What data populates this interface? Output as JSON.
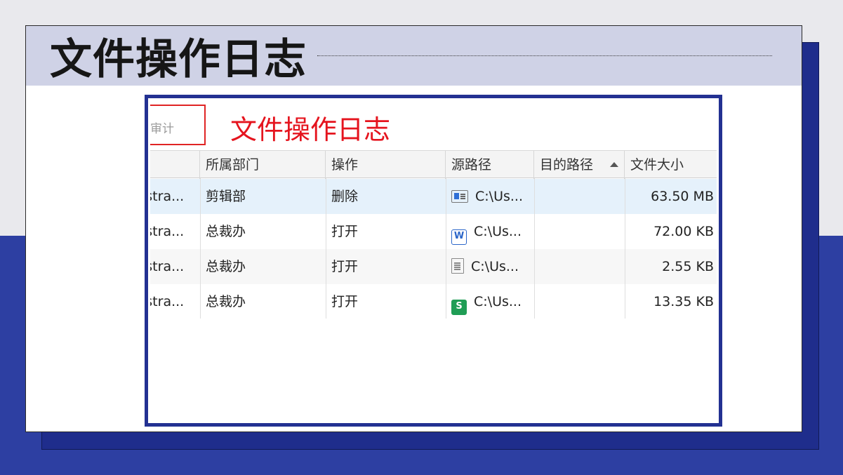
{
  "slide": {
    "title": "文件操作日志"
  },
  "screenshot": {
    "audit_tab_label": "操作审计",
    "overlay_title": "文件操作日志",
    "columns": [
      "所属部门",
      "操作",
      "源路径",
      "目的路径",
      "文件大小"
    ],
    "sorted_column": "目的路径",
    "rows": [
      {
        "user": "Administrator",
        "user_visible": "istra...",
        "dept": "剪辑部",
        "action": "删除",
        "icon": "video-file-icon",
        "src": "C:\\Us...",
        "dst": "",
        "size": "63.50 MB",
        "selected": true
      },
      {
        "user": "Administrator",
        "user_visible": "istra...",
        "dept": "总裁办",
        "action": "打开",
        "icon": "word-file-icon",
        "src": "C:\\Us...",
        "dst": "",
        "size": "72.00 KB",
        "selected": false
      },
      {
        "user": "Administrator",
        "user_visible": "istra...",
        "dept": "总裁办",
        "action": "打开",
        "icon": "text-file-icon",
        "src": "C:\\Us...",
        "dst": "",
        "size": "2.55 KB",
        "selected": false
      },
      {
        "user": "Administrator",
        "user_visible": "istra...",
        "dept": "总裁办",
        "action": "打开",
        "icon": "spreadsheet-file-icon",
        "src": "C:\\Us...",
        "dst": "",
        "size": "13.35 KB",
        "selected": false
      }
    ]
  },
  "colors": {
    "accent_blue": "#233192",
    "title_red": "#e5141e",
    "selected_row": "#e5f1fb",
    "alt_row": "#f7f7f7"
  }
}
